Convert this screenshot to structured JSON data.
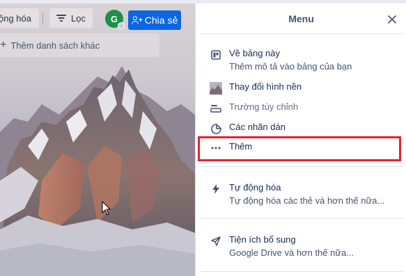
{
  "toolbar": {
    "automation_label": "ộng hóa",
    "filter_label": "Lọc",
    "avatar_initial": "G",
    "share_label": "Chia sẻ"
  },
  "board": {
    "add_list_label": "Thêm danh sách khác"
  },
  "menu": {
    "title": "Menu",
    "items": [
      {
        "label": "Về bảng này",
        "desc": "Thêm mô tả vào bảng của bạn",
        "icon": "board-icon"
      },
      {
        "label": "Thay đổi hình nền",
        "icon": "background-thumbnail-icon"
      },
      {
        "label": "Trường tùy chỉnh",
        "icon": "custom-fields-icon"
      },
      {
        "label": "Các nhãn dán",
        "icon": "sticker-icon"
      },
      {
        "label": "Thêm",
        "icon": "more-icon"
      },
      {
        "label": "Tự động hóa",
        "desc": "Tự động hóa các thẻ và hơn thế nữa...",
        "icon": "lightning-icon"
      },
      {
        "label": "Tiện ích bổ sung",
        "desc": "Google Drive và hơn thế nữa...",
        "icon": "rocket-icon"
      }
    ]
  },
  "colors": {
    "accent": "#0c66e4",
    "highlight": "#e3242b",
    "avatar": "#1f8f4d"
  }
}
